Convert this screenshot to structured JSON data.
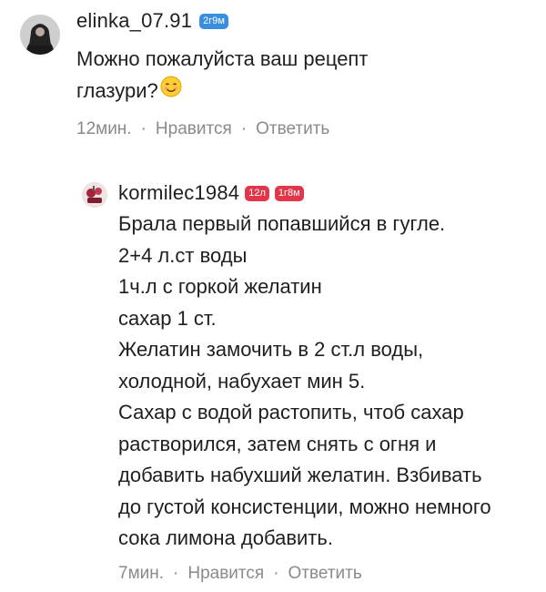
{
  "comments": [
    {
      "username": "elinka_07.91",
      "badges": [
        "2г9м"
      ],
      "text_lines": [
        "Можно пожалуйста ваш рецепт",
        "глазури?"
      ],
      "emoji": "smiling-face-icon",
      "time": "12мин.",
      "like_label": "Нравится",
      "reply_label": "Ответить",
      "separator": "·"
    },
    {
      "username": "kormilec1984",
      "badges": [
        "12л",
        "1г8м"
      ],
      "text_lines": [
        "Брала первый попавшийся в гугле.",
        "2+4 л.ст воды",
        "1ч.л с горкой желатин",
        "сахар 1 ст.",
        "Желатин замочить в 2 ст.л воды,",
        "холодной, набухает мин 5.",
        "Сахар с водой растопить, чтоб сахар",
        "растворился, затем снять с огня и",
        "добавить набухший желатин. Взбивать",
        "до густой консистенции, можно немного",
        "сока лимона добавить."
      ],
      "time": "7мин.",
      "like_label": "Нравится",
      "reply_label": "Ответить",
      "separator": "·"
    }
  ],
  "colors": {
    "badge_blue": "#3a8ee0",
    "badge_red": "#e2374a",
    "meta_gray": "#8a8a8a"
  }
}
